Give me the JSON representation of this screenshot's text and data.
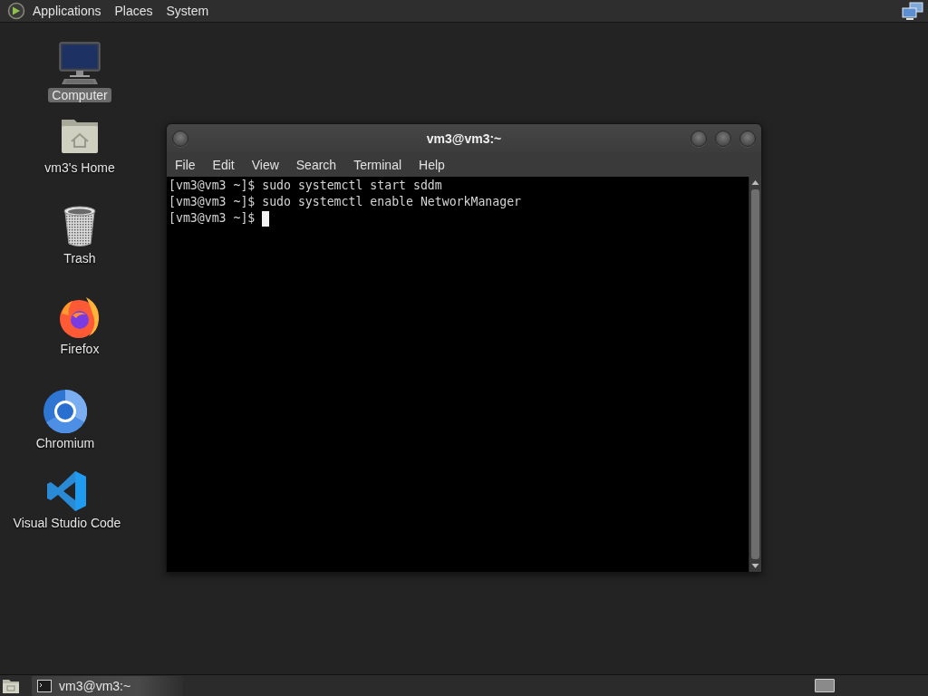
{
  "top_panel": {
    "menus": [
      {
        "label": "Applications"
      },
      {
        "label": "Places"
      },
      {
        "label": "System"
      }
    ]
  },
  "desktop_icons": [
    {
      "label": "Computer",
      "kind": "computer",
      "selected": true
    },
    {
      "label": "vm3's Home",
      "kind": "home",
      "selected": false
    },
    {
      "label": "Trash",
      "kind": "trash",
      "selected": false
    },
    {
      "label": "Firefox",
      "kind": "firefox",
      "selected": false
    },
    {
      "label": "Chromium",
      "kind": "chromium",
      "selected": false
    },
    {
      "label": "Visual Studio Code",
      "kind": "vscode",
      "selected": false
    }
  ],
  "terminal_window": {
    "title": "vm3@vm3:~",
    "menus": [
      "File",
      "Edit",
      "View",
      "Search",
      "Terminal",
      "Help"
    ],
    "lines": [
      "[vm3@vm3 ~]$ sudo systemctl start sddm",
      "[vm3@vm3 ~]$ sudo systemctl enable NetworkManager",
      "[vm3@vm3 ~]$"
    ],
    "cursor": true
  },
  "taskbar": {
    "windows": [
      {
        "label": "vm3@vm3:~",
        "selected": true
      }
    ]
  }
}
